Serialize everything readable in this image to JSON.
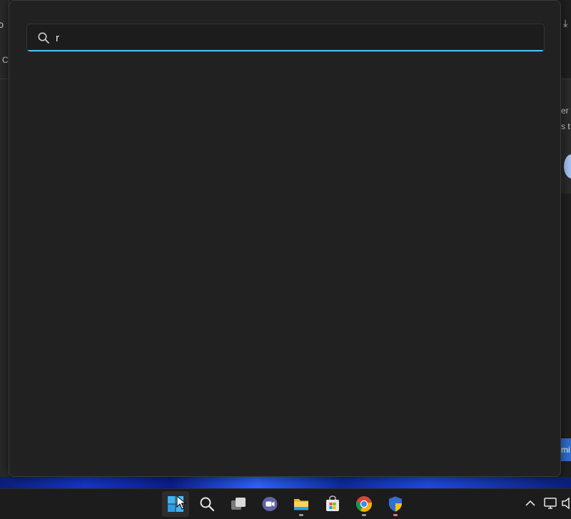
{
  "search": {
    "query": "r",
    "accent_color": "#4cc2ff"
  },
  "background_window": {
    "left_glyph_1": "ↄ",
    "left_glyph_2": "C",
    "right_text_1": "er l",
    "right_text_2": "s t",
    "right_button": "mi"
  },
  "taskbar": {
    "items": [
      {
        "name": "start",
        "icon": "windows-logo-icon"
      },
      {
        "name": "search",
        "icon": "search-icon"
      },
      {
        "name": "task-view",
        "icon": "task-view-icon"
      },
      {
        "name": "teams-chat",
        "icon": "teams-camera-icon"
      },
      {
        "name": "file-explorer",
        "icon": "folder-icon"
      },
      {
        "name": "microsoft-store",
        "icon": "store-bag-icon"
      },
      {
        "name": "chrome",
        "icon": "chrome-icon"
      },
      {
        "name": "security",
        "icon": "shield-icon"
      }
    ],
    "tray": [
      {
        "name": "show-hidden-icons",
        "icon": "chevron-up-icon"
      },
      {
        "name": "network",
        "icon": "network-icon"
      },
      {
        "name": "volume",
        "icon": "speaker-icon"
      }
    ]
  }
}
